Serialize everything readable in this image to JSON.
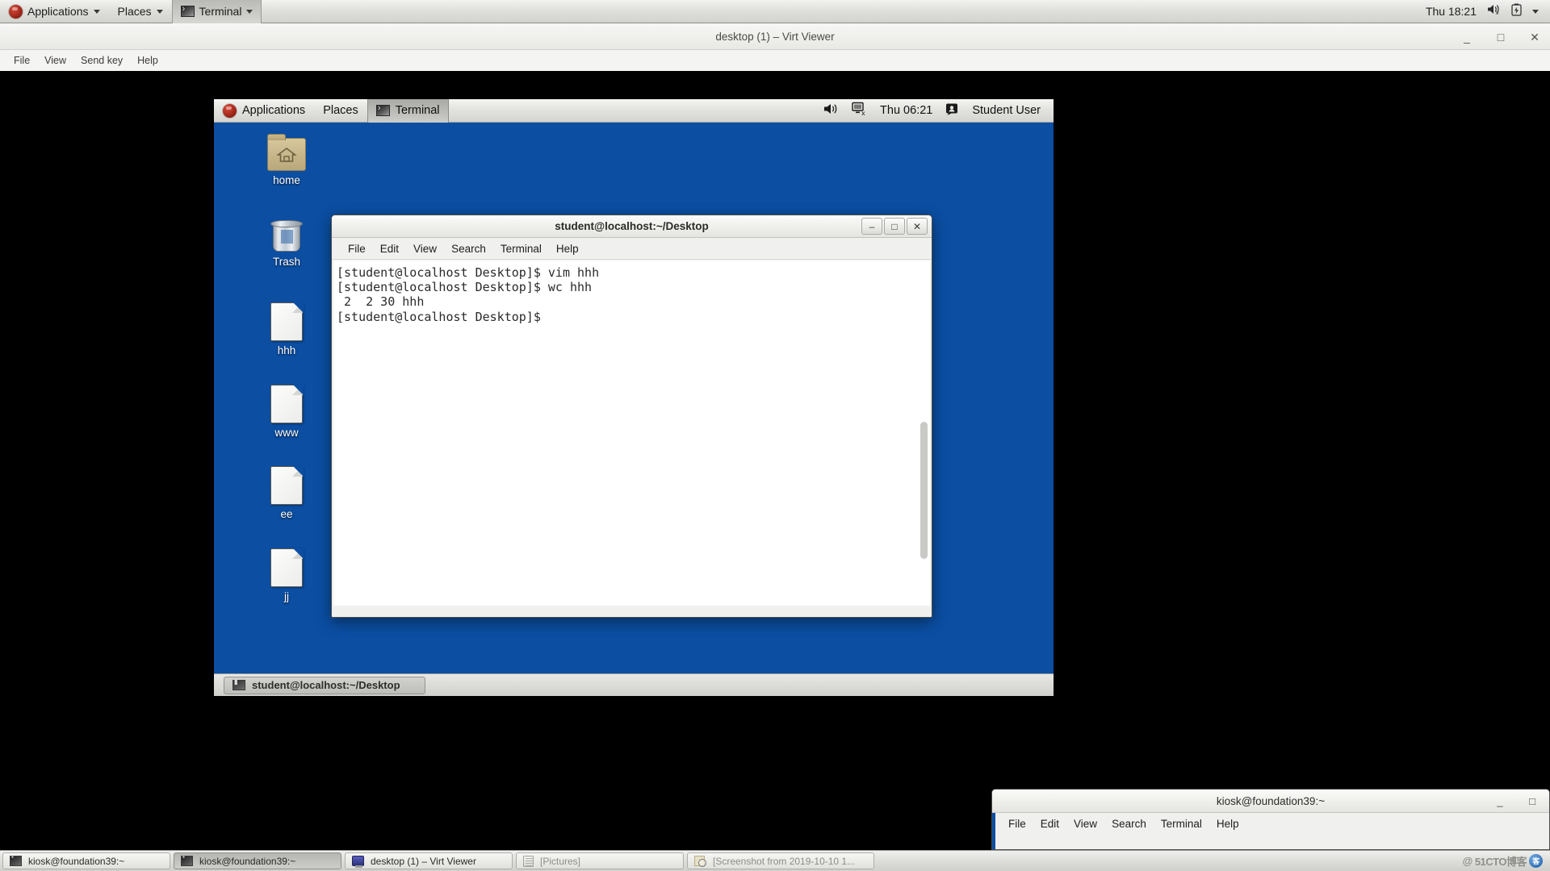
{
  "host_panel": {
    "applications_label": "Applications",
    "places_label": "Places",
    "terminal_label": "Terminal",
    "clock": "Thu 18:21",
    "icons": [
      "volume-muted-icon",
      "battery-icon",
      "chevron-down-icon"
    ]
  },
  "virt_viewer": {
    "title": "desktop (1) – Virt Viewer",
    "window_buttons": {
      "minimize": "_",
      "maximize": "□",
      "close": "✕"
    },
    "menus": [
      "File",
      "View",
      "Send key",
      "Help"
    ]
  },
  "guest_panel": {
    "applications_label": "Applications",
    "places_label": "Places",
    "terminal_label": "Terminal",
    "clock": "Thu 06:21",
    "user": "Student User",
    "icons": [
      "volume-icon",
      "network-disconnected-icon",
      "user-icon"
    ]
  },
  "desktop_icons": [
    {
      "label": "home",
      "type": "folder"
    },
    {
      "label": "Trash",
      "type": "trash"
    },
    {
      "label": "hhh",
      "type": "file"
    },
    {
      "label": "www",
      "type": "file"
    },
    {
      "label": "ee",
      "type": "file"
    },
    {
      "label": "jj",
      "type": "file"
    }
  ],
  "guest_terminal": {
    "title": "student@localhost:~/Desktop",
    "menus": [
      "File",
      "Edit",
      "View",
      "Search",
      "Terminal",
      "Help"
    ],
    "window_buttons": {
      "minimize": "–",
      "maximize": "□",
      "close": "✕"
    },
    "content": "[student@localhost Desktop]$ vim hhh\n[student@localhost Desktop]$ wc hhh\n 2  2 30 hhh\n[student@localhost Desktop]$ "
  },
  "guest_taskbar": {
    "task_label": "student@localhost:~/Desktop"
  },
  "host_terminal": {
    "title": "kiosk@foundation39:~",
    "menus": [
      "File",
      "Edit",
      "View",
      "Search",
      "Terminal",
      "Help"
    ],
    "window_buttons": {
      "minimize": "_",
      "maximize": "□"
    }
  },
  "host_taskbar": {
    "buttons": [
      {
        "label": "kiosk@foundation39:~",
        "icon": "terminal-icon",
        "state": "normal"
      },
      {
        "label": "kiosk@foundation39:~",
        "icon": "terminal-icon",
        "state": "pressed"
      },
      {
        "label": "desktop (1) – Virt Viewer",
        "icon": "virt-viewer-icon",
        "state": "normal"
      },
      {
        "label": "[Pictures]",
        "icon": "files-icon",
        "state": "dim"
      },
      {
        "label": "[Screenshot from 2019-10-10 1...",
        "icon": "screenshot-icon",
        "state": "dim"
      }
    ],
    "watermark": "51CTO博客",
    "watermark_badge": "@"
  },
  "colors": {
    "desktop_blue": "#0b4ea2",
    "panel_gray": "#dededa",
    "terminal_bg": "#ffffff",
    "terminal_fg": "#2a2a2a"
  }
}
